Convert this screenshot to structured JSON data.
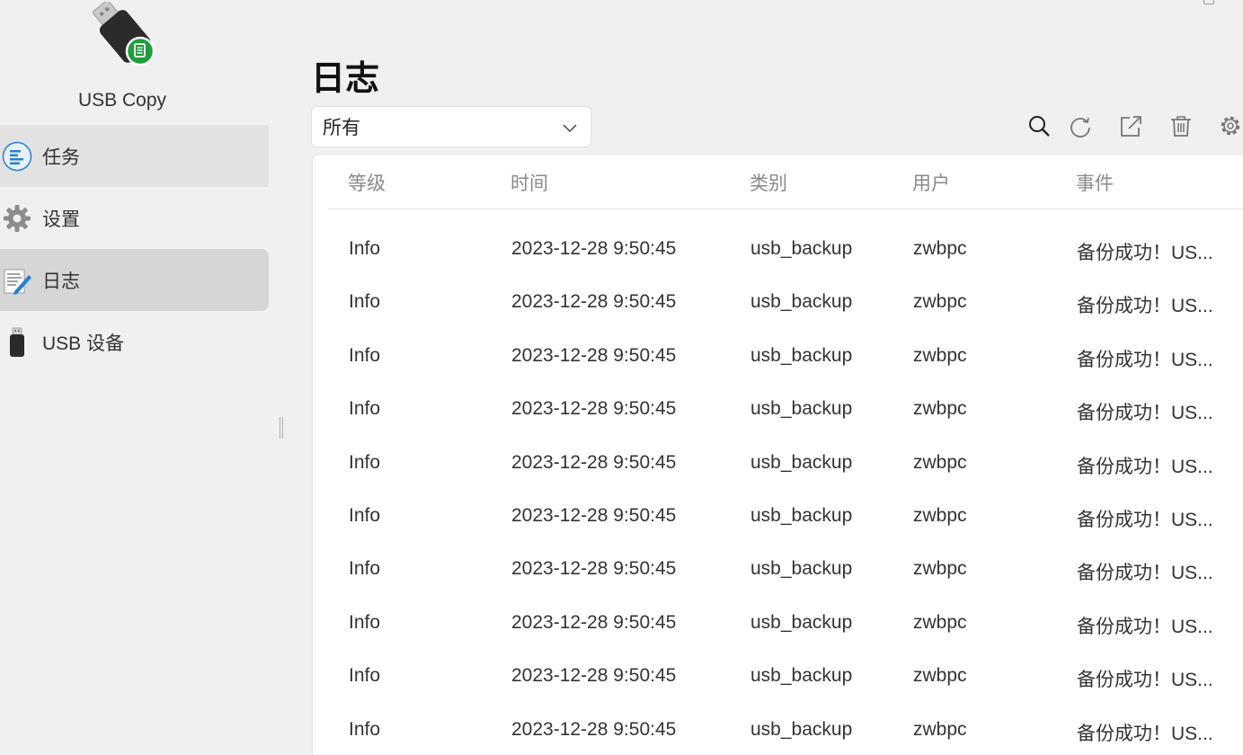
{
  "app": {
    "name": "USB Copy",
    "colors": {
      "accent": "#1f9d3a",
      "sidebar_active": "#d6d6d6",
      "background": "#f0f0f0"
    }
  },
  "sidebar": {
    "items": [
      {
        "label": "任务",
        "icon": "tasks-icon"
      },
      {
        "label": "设置",
        "icon": "gear-icon"
      },
      {
        "label": "日志",
        "icon": "log-icon",
        "active": true
      },
      {
        "label": "USB 设备",
        "icon": "usb-drive-icon"
      }
    ]
  },
  "main": {
    "title": "日志",
    "filter": {
      "selected": "所有"
    },
    "toolbar": [
      "search-icon",
      "refresh-icon",
      "export-icon",
      "trash-icon",
      "gear-icon"
    ],
    "table": {
      "columns": [
        "等级",
        "时间",
        "类别",
        "用户",
        "事件"
      ],
      "rows": [
        [
          "Info",
          "2023-12-28 9:50:45",
          "usb_backup",
          "zwbpc",
          "备份成功！US..."
        ],
        [
          "Info",
          "2023-12-28 9:50:45",
          "usb_backup",
          "zwbpc",
          "备份成功！US..."
        ],
        [
          "Info",
          "2023-12-28 9:50:45",
          "usb_backup",
          "zwbpc",
          "备份成功！US..."
        ],
        [
          "Info",
          "2023-12-28 9:50:45",
          "usb_backup",
          "zwbpc",
          "备份成功！US..."
        ],
        [
          "Info",
          "2023-12-28 9:50:45",
          "usb_backup",
          "zwbpc",
          "备份成功！US..."
        ],
        [
          "Info",
          "2023-12-28 9:50:45",
          "usb_backup",
          "zwbpc",
          "备份成功！US..."
        ],
        [
          "Info",
          "2023-12-28 9:50:45",
          "usb_backup",
          "zwbpc",
          "备份成功！US..."
        ],
        [
          "Info",
          "2023-12-28 9:50:45",
          "usb_backup",
          "zwbpc",
          "备份成功！US..."
        ],
        [
          "Info",
          "2023-12-28 9:50:45",
          "usb_backup",
          "zwbpc",
          "备份成功！US..."
        ],
        [
          "Info",
          "2023-12-28 9:50:45",
          "usb_backup",
          "zwbpc",
          "备份成功！US..."
        ]
      ]
    }
  }
}
